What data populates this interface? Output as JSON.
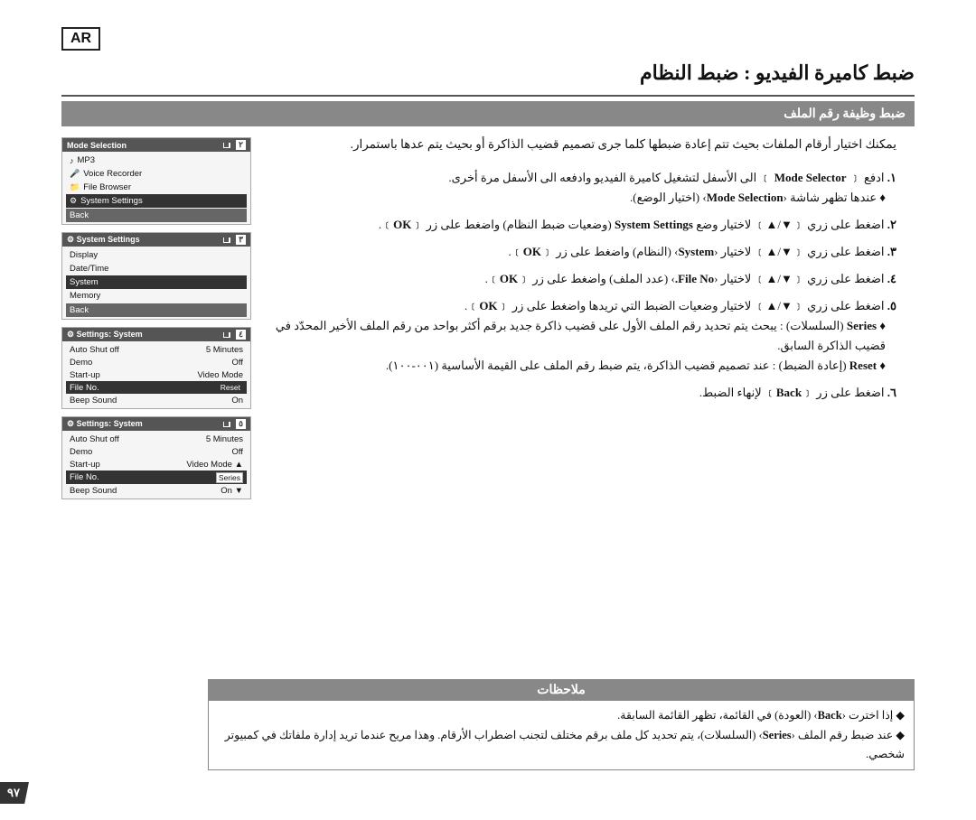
{
  "page": {
    "page_number": "٩٧",
    "ar_badge": "AR",
    "title": "ضبط كاميرة الفيديو : ضبط النظام",
    "section_header": "ضبط وظيفة رقم الملف",
    "intro_text": "يمكنك اختيار أرقام الملفات بحيث تتم إعادة ضبطها كلما جرى تصميم قضيب الذاكرة أو بحيث يتم عدها باستمرار.",
    "steps": [
      {
        "num": "١",
        "text": "ادفع ﹝ Mode Selector ﹞ الى الأسفل لتشغيل كاميرة الفيديو وادفعه الى الأسفل مرة أخرى.",
        "sub": "♦ عندها تظهر شاشة ‹Mode Selection› (اختيار الوضع)."
      },
      {
        "num": "٢",
        "text": "اضغط على زري ﹝▼/▲﹞ لاختيار وضع System Settings (وضعيات ضبط النظام) واضغط على زر ﹝OK﹞.",
        "sub": ""
      },
      {
        "num": "٣",
        "text": "اضغط على زري ﹝▼/▲﹞ لاختيار ‹System› (النظام) واضغط على زر ﹝OK﹞.",
        "sub": ""
      },
      {
        "num": "٤",
        "text": "اضغط على زري ﹝▼/▲﹞ لاختيار ‹File No.› (عدد الملف) واضغط على زر ﹝OK﹞.",
        "sub": ""
      },
      {
        "num": "٥",
        "text": "اضغط على زري ﹝▼/▲﹞ لاختيار وضعيات الضبط التي تريدها واضغط على زر ﹝OK﹞.",
        "sub1": "♦ Series (السلسلات) : يبحث يتم تحديد رقم الملف الأول على قضيب ذاكرة جديد برقم أكثر بواحد من رقم الملف الأخير المحدّد في قضيب الذاكرة السابق.",
        "sub2": "♦ Reset (إعادة الضبط) : عند تصميم قضيب الذاكرة، يتم ضبط رقم الملف على القيمة الأساسية (٠٠١-١٠٠)."
      },
      {
        "num": "٦",
        "text": "اضغط على زر ﹝Back﹞ لإنهاء الضبط.",
        "sub": ""
      }
    ],
    "notes": {
      "title": "ملاحظات",
      "lines": [
        "◆ إذا اخترت ‹Back› (العودة) في القائمة، تظهر القائمة السابقة.",
        "◆ عند ضبط رقم الملف ‹Series› (السلسلات)، يتم تحديد كل ملف برقم مختلف لتجنب اضطراب الأرقام. وهذا مريح عندما تريد إدارة ملفاتك في كمبيوتر شخصي."
      ]
    },
    "device_screens": [
      {
        "step": "٢",
        "title": "Mode Selection",
        "items": [
          "MP3",
          "Voice Recorder",
          "File Browser",
          "System Settings"
        ],
        "selected": "System Settings",
        "back": "Back",
        "type": "mode_selection"
      },
      {
        "step": "٣",
        "title": "System Settings",
        "items": [
          "Display",
          "Date/Time",
          "System",
          "Memory"
        ],
        "selected": "Memory",
        "back": "Back",
        "type": "system_settings"
      },
      {
        "step": "٤",
        "title": "Settings: System",
        "rows": [
          {
            "label": "Auto Shut off",
            "value": "5 Minutes"
          },
          {
            "label": "Demo",
            "value": "Off"
          },
          {
            "label": "Start-up",
            "value": "Video Mode"
          },
          {
            "label": "File No.",
            "value": "Reset",
            "highlighted": true
          },
          {
            "label": "Beep Sound",
            "value": "On"
          }
        ],
        "type": "settings_system_reset"
      },
      {
        "step": "٥",
        "title": "Settings: System",
        "rows": [
          {
            "label": "Auto Shut off",
            "value": "5 Minutes"
          },
          {
            "label": "Demo",
            "value": "Off"
          },
          {
            "label": "Start-up",
            "value": "Video Mode"
          },
          {
            "label": "File No.",
            "value": "Series",
            "highlighted": true
          },
          {
            "label": "Beep Sound",
            "value": "On"
          }
        ],
        "type": "settings_system_series"
      }
    ]
  }
}
